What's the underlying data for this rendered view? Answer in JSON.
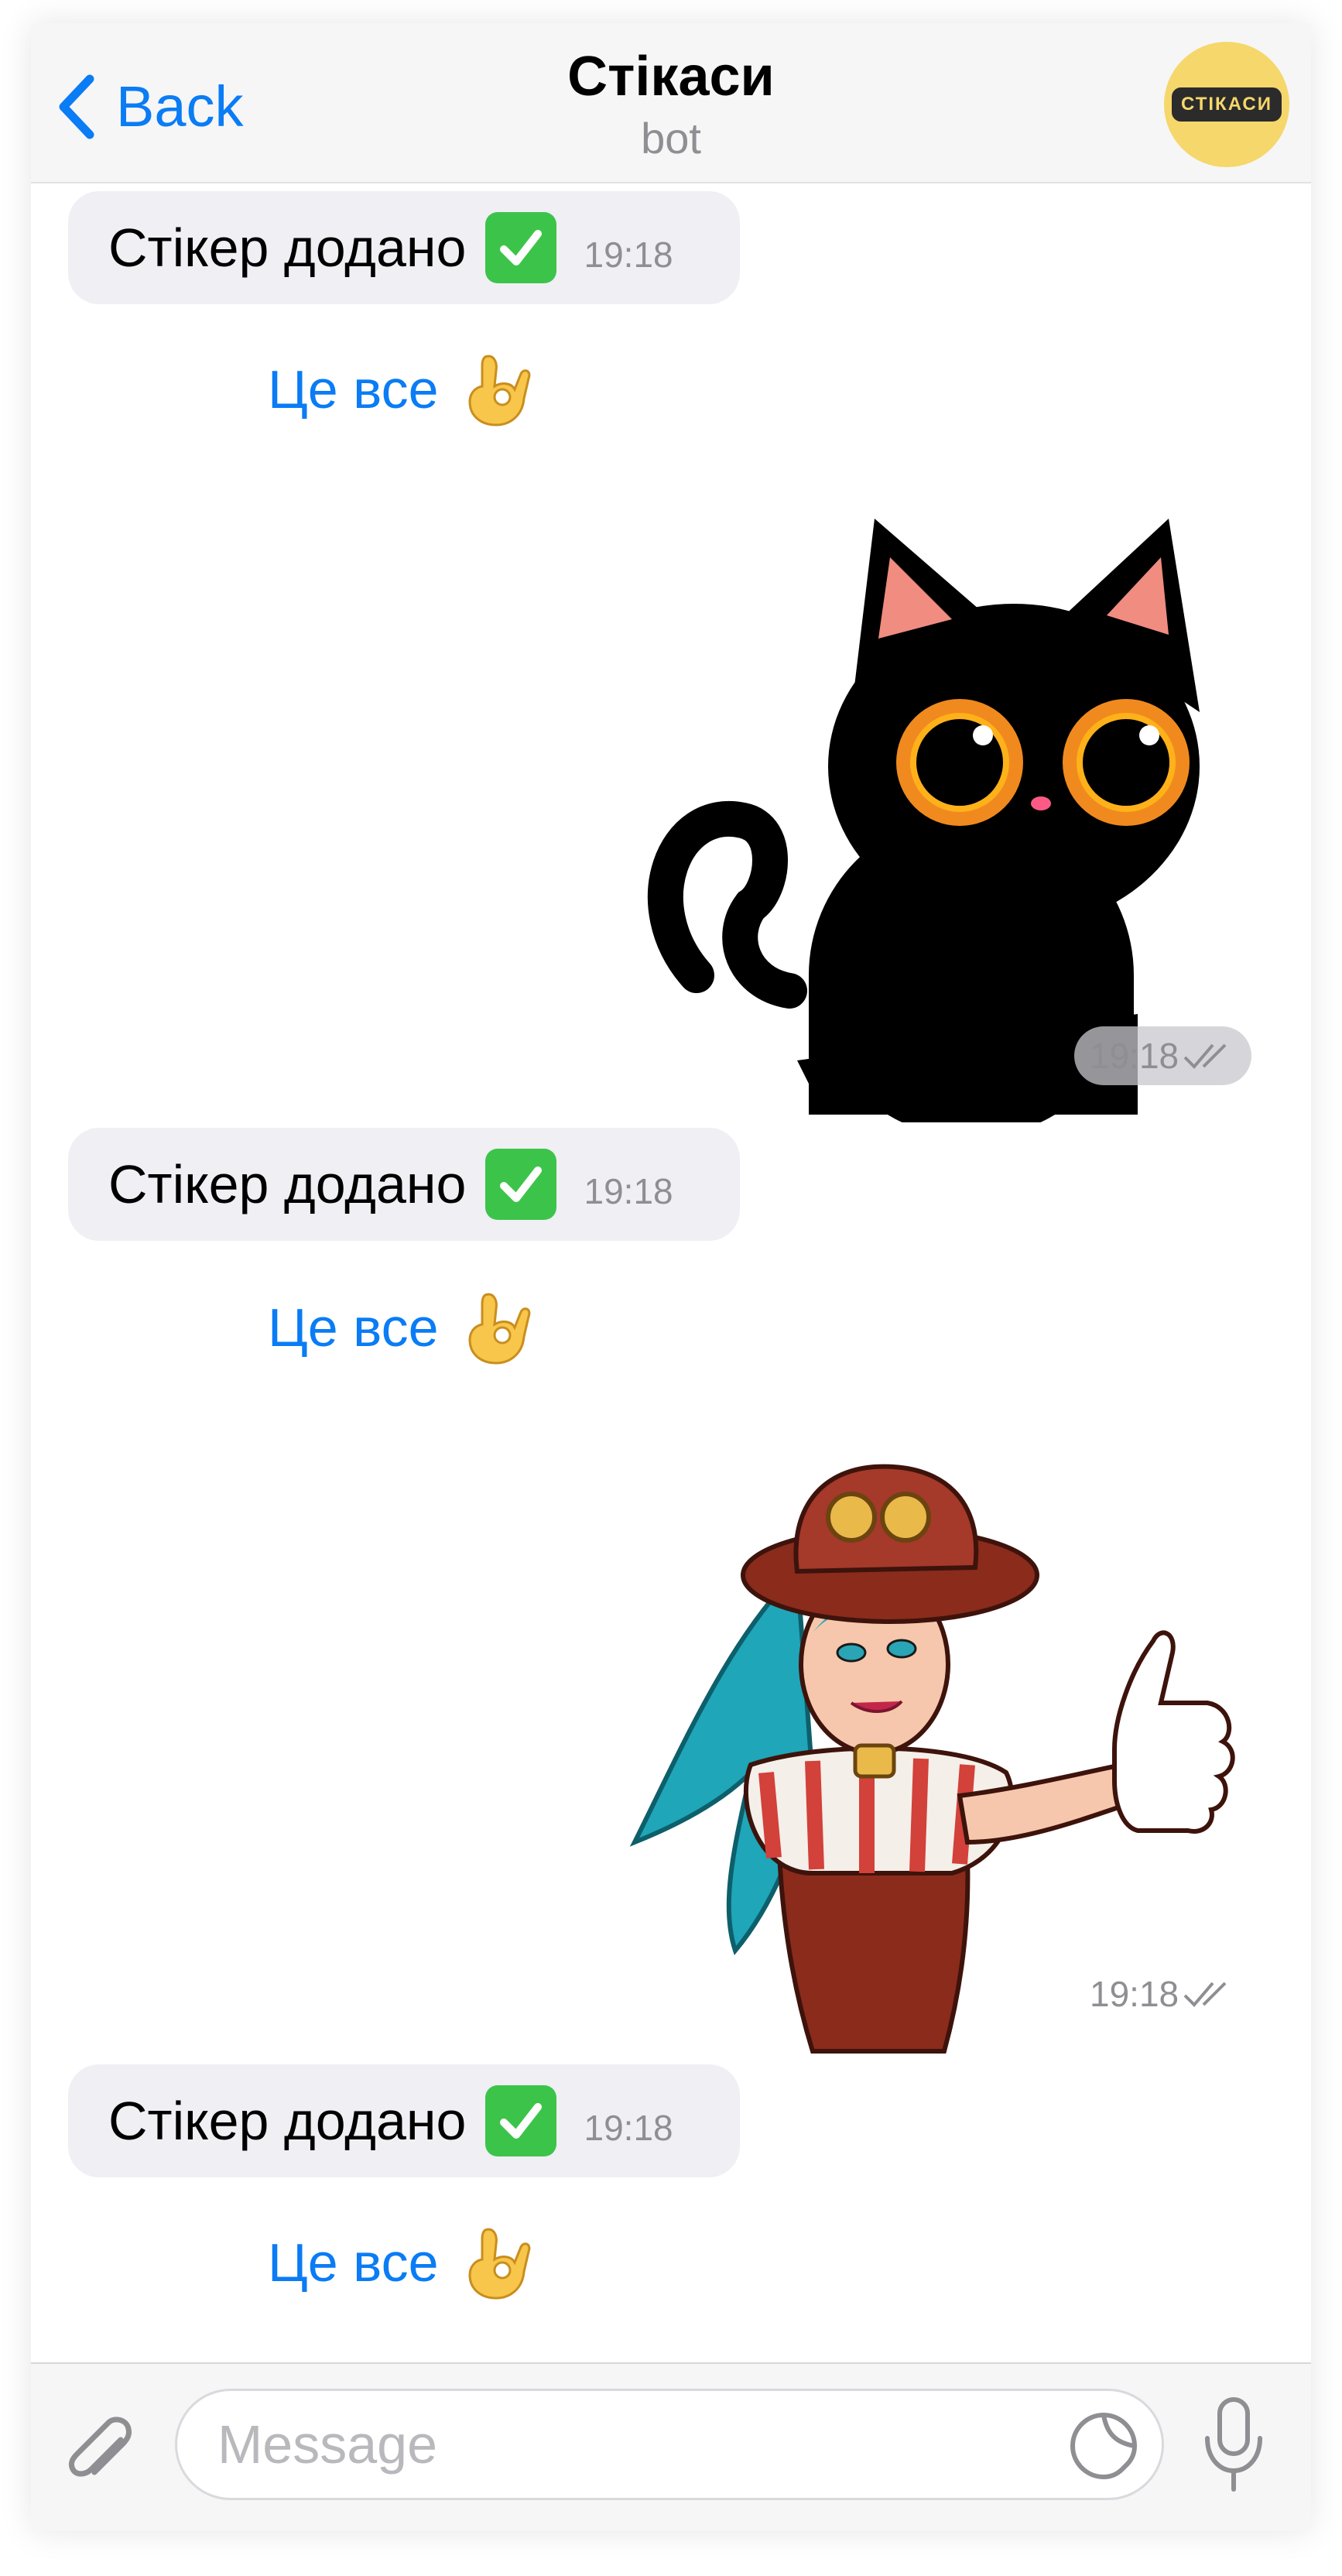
{
  "header": {
    "back_label": "Back",
    "title": "Стікаси",
    "subtitle": "bot",
    "avatar_text": "СТІКАСИ"
  },
  "messages": [
    {
      "type": "bot_text",
      "text": "Стікер додано",
      "emoji": "check-mark-button-icon",
      "time": "19:18"
    },
    {
      "type": "quick_reply",
      "text": "Це все",
      "emoji": "ok-hand-icon"
    },
    {
      "type": "sticker",
      "sticker": "black-cat-sticker",
      "time": "19:18",
      "status": "read"
    },
    {
      "type": "bot_text",
      "text": "Стікер додано",
      "emoji": "check-mark-button-icon",
      "time": "19:18"
    },
    {
      "type": "quick_reply",
      "text": "Це все",
      "emoji": "ok-hand-icon"
    },
    {
      "type": "sticker",
      "sticker": "steampunk-girl-thumbs-up-sticker",
      "time": "19:18",
      "status": "read"
    },
    {
      "type": "bot_text",
      "text": "Стікер додано",
      "emoji": "check-mark-button-icon",
      "time": "19:18"
    },
    {
      "type": "quick_reply",
      "text": "Це все",
      "emoji": "ok-hand-icon"
    }
  ],
  "input": {
    "placeholder": "Message",
    "value": ""
  },
  "colors": {
    "accent": "#0a7cf5",
    "bubble": "#efeff4",
    "avatar": "#f5d76b",
    "meta": "#8e8e93"
  }
}
